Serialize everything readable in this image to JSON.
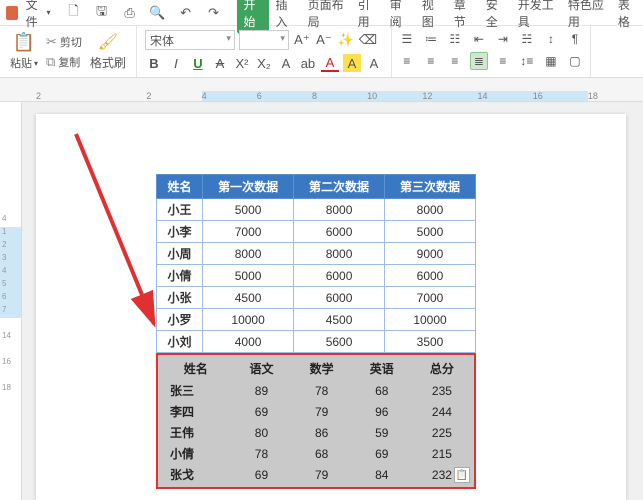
{
  "menubar": {
    "file_label": "文件",
    "tabs": [
      "开始",
      "插入",
      "页面布局",
      "引用",
      "审阅",
      "视图",
      "章节",
      "安全",
      "开发工具",
      "特色应用",
      "表格"
    ],
    "active_tab": 0
  },
  "ribbon": {
    "paste": "粘贴",
    "cut": "剪切",
    "copy": "复制",
    "format_painter": "格式刷",
    "font_name": "宋体",
    "font_size": "",
    "bold": "B",
    "italic": "I",
    "underline": "U",
    "strike": "A",
    "x2": "X²",
    "x2b": "X₂",
    "a_case": "A",
    "ab": "ab",
    "a_color": "A",
    "a_hi": "A",
    "a_clear": "A"
  },
  "ruler_h": [
    "2",
    "",
    "2",
    "4",
    "6",
    "8",
    "10",
    "12",
    "14",
    "16",
    "18"
  ],
  "ruler_v_top": [
    "",
    "",
    "",
    "",
    "4"
  ],
  "ruler_v_sel": [
    "1",
    "2",
    "3",
    "4",
    "5",
    "6",
    "7"
  ],
  "ruler_v_bot": [
    "",
    "14",
    "",
    "16",
    "",
    "18",
    ""
  ],
  "table1": {
    "headers": [
      "姓名",
      "第一次数据",
      "第二次数据",
      "第三次数据"
    ],
    "rows": [
      [
        "小王",
        "5000",
        "8000",
        "8000"
      ],
      [
        "小李",
        "7000",
        "6000",
        "5000"
      ],
      [
        "小周",
        "8000",
        "8000",
        "9000"
      ],
      [
        "小倩",
        "5000",
        "6000",
        "6000"
      ],
      [
        "小张",
        "4500",
        "6000",
        "7000"
      ],
      [
        "小罗",
        "10000",
        "4500",
        "10000"
      ],
      [
        "小刘",
        "4000",
        "5600",
        "3500"
      ]
    ]
  },
  "table2": {
    "headers": [
      "姓名",
      "语文",
      "数学",
      "英语",
      "总分"
    ],
    "rows": [
      [
        "张三",
        "89",
        "78",
        "68",
        "235"
      ],
      [
        "李四",
        "69",
        "79",
        "96",
        "244"
      ],
      [
        "王伟",
        "80",
        "86",
        "59",
        "225"
      ],
      [
        "小倩",
        "78",
        "68",
        "69",
        "215"
      ],
      [
        "张戈",
        "69",
        "79",
        "84",
        "232"
      ]
    ]
  }
}
